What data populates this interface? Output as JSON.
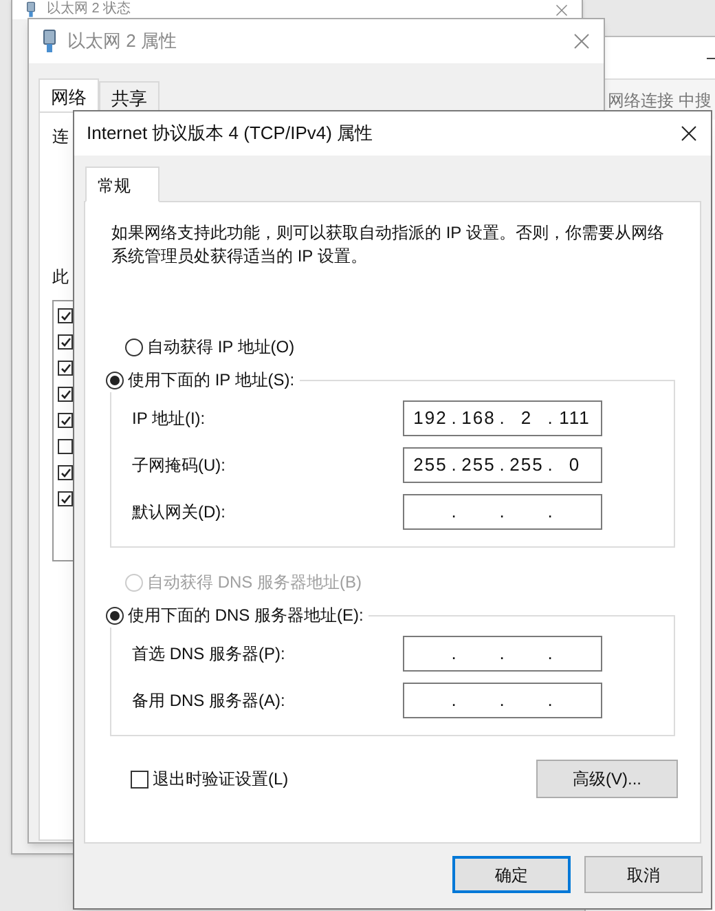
{
  "back_windows": [
    {
      "title": "以太网 2 状态"
    },
    {
      "title": "以太网 2 属性",
      "tabs": [
        {
          "label": "网络",
          "selected": true
        },
        {
          "label": "共享",
          "selected": false
        }
      ],
      "labels": [
        "连",
        "此"
      ],
      "components": [
        {
          "checked": true
        },
        {
          "checked": true
        },
        {
          "checked": true
        },
        {
          "checked": true
        },
        {
          "checked": true
        },
        {
          "checked": false
        },
        {
          "checked": true
        },
        {
          "checked": true
        }
      ]
    },
    {
      "search_hint": "网络连接 中搜"
    }
  ],
  "dialog": {
    "title": "Internet 协议版本 4 (TCP/IPv4) 属性",
    "tabs": [
      {
        "label": "常规",
        "selected": true
      }
    ],
    "description": "如果网络支持此功能，则可以获取自动指派的 IP 设置。否则，你需要从网络系统管理员处获得适当的 IP 设置。",
    "ip_mode": [
      {
        "label": "自动获得 IP 地址(O)",
        "selected": false,
        "disabled": false
      },
      {
        "label": "使用下面的 IP 地址(S):",
        "selected": true,
        "disabled": false
      }
    ],
    "ip_fields": [
      {
        "label": "IP 地址(I):",
        "octets": [
          "192",
          "168",
          "2",
          "111"
        ]
      },
      {
        "label": "子网掩码(U):",
        "octets": [
          "255",
          "255",
          "255",
          "0"
        ]
      },
      {
        "label": "默认网关(D):"
      }
    ],
    "dns_mode": [
      {
        "label": "自动获得 DNS 服务器地址(B)",
        "selected": false,
        "disabled": true
      },
      {
        "label": "使用下面的 DNS 服务器地址(E):",
        "selected": true,
        "disabled": false
      }
    ],
    "dns_fields": [
      {
        "label": "首选 DNS 服务器(P):"
      },
      {
        "label": "备用 DNS 服务器(A):"
      }
    ],
    "validate": {
      "label": "退出时验证设置(L)",
      "checked": false
    },
    "advanced_button": "高级(V)...",
    "ip_separator": ".",
    "buttons": [
      {
        "label": "确定",
        "default": true
      },
      {
        "label": "取消",
        "default": false
      }
    ]
  }
}
